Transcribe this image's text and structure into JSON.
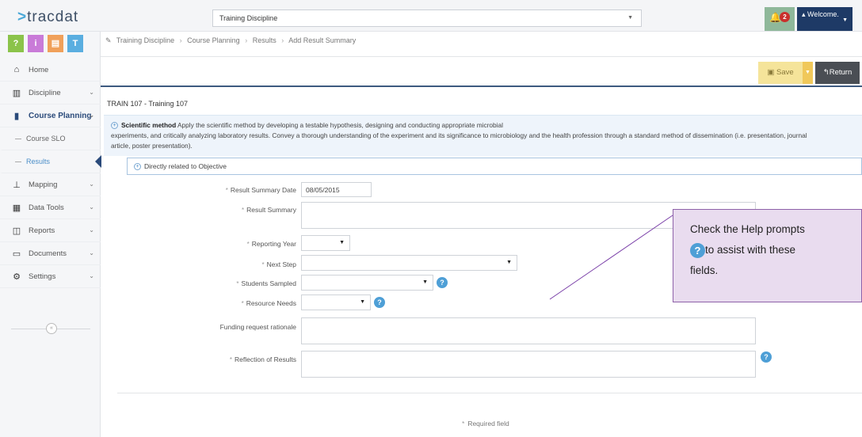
{
  "app": {
    "logo_text": "tracdat",
    "discipline_select": "Training Discipline"
  },
  "header": {
    "bell_count": "2",
    "welcome_label": "Welcome."
  },
  "sidebar": {
    "tiles": [
      {
        "label": "?",
        "color": "#8bc34a"
      },
      {
        "label": "i",
        "color": "#c97bd8"
      },
      {
        "label": "▤",
        "color": "#f0a05a"
      },
      {
        "label": "T",
        "color": "#5aaee0"
      }
    ],
    "items": [
      {
        "label": "Home"
      },
      {
        "label": "Discipline"
      },
      {
        "label": "Course Planning"
      },
      {
        "label": "Course SLO"
      },
      {
        "label": "Results"
      },
      {
        "label": "Mapping"
      },
      {
        "label": "Data Tools"
      },
      {
        "label": "Reports"
      },
      {
        "label": "Documents"
      },
      {
        "label": "Settings"
      }
    ]
  },
  "breadcrumb": [
    "Training Discipline",
    "Course Planning",
    "Results",
    "Add Result Summary"
  ],
  "toolbar": {
    "save_label": "Save",
    "return_label": "Return"
  },
  "course_title": "TRAIN 107 - Training 107",
  "objective": {
    "title": "Scientific method",
    "text_line1": "Apply the scientific method by developing a testable hypothesis, designing and conducting appropriate microbial",
    "text_line2": "experiments, and critically analyzing laboratory results. Convey a thorough understanding of the experiment and its significance to microbiology and the health profession through a standard method of dissemination (i.e. presentation, journal",
    "text_line3": "article, poster presentation).",
    "related_label": "Directly related to Objective"
  },
  "form": {
    "result_summary_date_label": "Result Summary Date",
    "result_summary_date_value": "08/05/2015",
    "result_summary_label": "Result Summary",
    "reporting_year_label": "Reporting Year",
    "next_step_label": "Next Step",
    "students_sampled_label": "Students Sampled",
    "resource_needs_label": "Resource Needs",
    "funding_label": "Funding request rationale",
    "reflection_label": "Reflection of Results",
    "required_note": "Required field"
  },
  "callout": {
    "line1": "Check the Help prompts",
    "line2": "to assist with these",
    "line3": "fields."
  }
}
